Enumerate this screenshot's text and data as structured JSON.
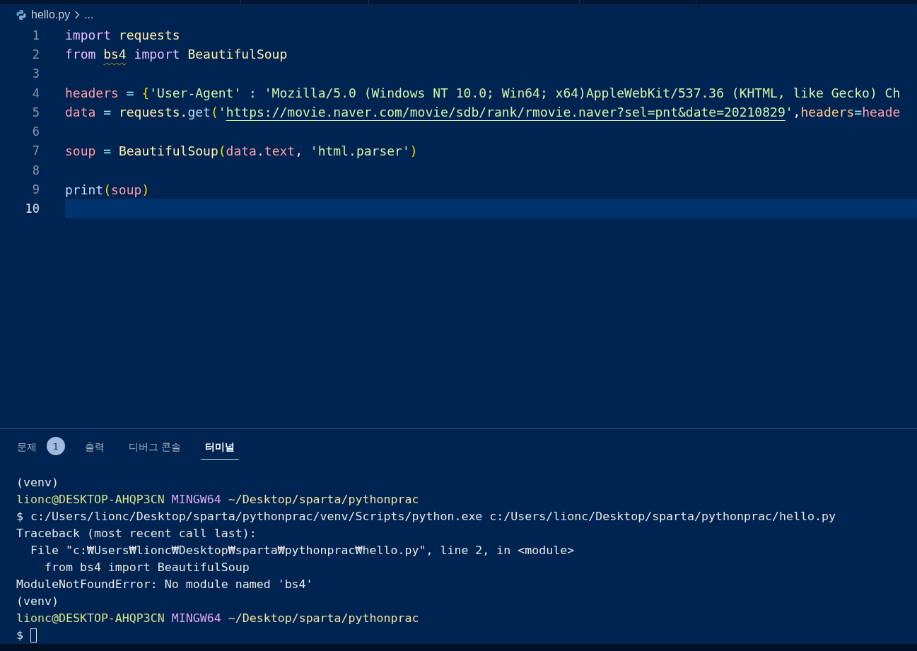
{
  "breadcrumb": {
    "file": "hello.py",
    "more": "..."
  },
  "editor": {
    "lines": [
      {
        "number": "1",
        "current": false,
        "tokens": [
          {
            "kind": "kw",
            "text": "import "
          },
          {
            "kind": "module",
            "text": "requests"
          }
        ]
      },
      {
        "number": "2",
        "current": false,
        "tokens": [
          {
            "kind": "kw",
            "text": "from "
          },
          {
            "kind": "warn",
            "text": "bs4"
          },
          {
            "kind": "kw",
            "text": " import "
          },
          {
            "kind": "module",
            "text": "BeautifulSoup"
          }
        ]
      },
      {
        "number": "3",
        "current": false
      },
      {
        "number": "4",
        "current": false,
        "tokens": [
          {
            "kind": "var",
            "text": "headers"
          },
          {
            "kind": "op",
            "text": " = "
          },
          {
            "kind": "bracket",
            "text": "{"
          },
          {
            "kind": "str",
            "text": "'User-Agent'"
          },
          {
            "kind": "op",
            "text": " : "
          },
          {
            "kind": "str",
            "text": "'Mozilla/5.0 (Windows NT 10.0; Win64; x64)AppleWebKit/537.36 (KHTML, like Gecko) Ch"
          }
        ]
      },
      {
        "number": "5",
        "current": false,
        "tokens": [
          {
            "kind": "var",
            "text": "data"
          },
          {
            "kind": "op",
            "text": " = "
          },
          {
            "kind": "module",
            "text": "requests"
          },
          {
            "kind": "text",
            "text": "."
          },
          {
            "kind": "fn",
            "text": "get"
          },
          {
            "kind": "bracket",
            "text": "("
          },
          {
            "kind": "str",
            "text": "'"
          },
          {
            "kind": "link",
            "text": "https://movie.naver.com/movie/sdb/rank/rmovie.naver?sel=pnt&date=20210829"
          },
          {
            "kind": "str",
            "text": "'"
          },
          {
            "kind": "text",
            "text": ","
          },
          {
            "kind": "param",
            "text": "headers"
          },
          {
            "kind": "op",
            "text": "="
          },
          {
            "kind": "var",
            "text": "heade"
          }
        ]
      },
      {
        "number": "6",
        "current": false
      },
      {
        "number": "7",
        "current": false,
        "tokens": [
          {
            "kind": "var",
            "text": "soup"
          },
          {
            "kind": "op",
            "text": " = "
          },
          {
            "kind": "module",
            "text": "BeautifulSoup"
          },
          {
            "kind": "bracket",
            "text": "("
          },
          {
            "kind": "var",
            "text": "data"
          },
          {
            "kind": "text",
            "text": "."
          },
          {
            "kind": "var",
            "text": "text"
          },
          {
            "kind": "text",
            "text": ", "
          },
          {
            "kind": "str",
            "text": "'html.parser'"
          },
          {
            "kind": "bracket",
            "text": ")"
          }
        ]
      },
      {
        "number": "8",
        "current": false
      },
      {
        "number": "9",
        "current": false,
        "tokens": [
          {
            "kind": "fn",
            "text": "print"
          },
          {
            "kind": "bracket",
            "text": "("
          },
          {
            "kind": "var",
            "text": "soup"
          },
          {
            "kind": "bracket",
            "text": ")"
          }
        ]
      },
      {
        "number": "10",
        "current": true
      }
    ]
  },
  "panel": {
    "tabs": [
      {
        "label": "문제",
        "badge": "1",
        "selected": false
      },
      {
        "label": "출력",
        "selected": false
      },
      {
        "label": "디버그 콘솔",
        "selected": false
      },
      {
        "label": "터미널",
        "selected": true
      }
    ]
  },
  "terminal": {
    "lines": [
      {
        "cursor": false,
        "segments": [
          {
            "kind": "plain",
            "text": "(venv)"
          }
        ]
      },
      {
        "cursor": false,
        "segments": [
          {
            "kind": "user",
            "text": "lionc@DESKTOP-AHQP3CN "
          },
          {
            "kind": "shell",
            "text": "MINGW64 "
          },
          {
            "kind": "path",
            "text": "~/Desktop/sparta/pythonprac"
          }
        ]
      },
      {
        "cursor": false,
        "segments": [
          {
            "kind": "plain",
            "text": "$ c:/Users/lionc/Desktop/sparta/pythonprac/venv/Scripts/python.exe c:/Users/lionc/Desktop/sparta/pythonprac/hello.py"
          }
        ]
      },
      {
        "cursor": false,
        "segments": [
          {
            "kind": "plain",
            "text": "Traceback (most recent call last):"
          }
        ]
      },
      {
        "cursor": false,
        "segments": [
          {
            "kind": "plain",
            "text": "  File \"c:₩Users₩lionc₩Desktop₩sparta₩pythonprac₩hello.py\", line 2, in <module>"
          }
        ]
      },
      {
        "cursor": false,
        "segments": [
          {
            "kind": "plain",
            "text": "    from bs4 import BeautifulSoup"
          }
        ]
      },
      {
        "cursor": false,
        "segments": [
          {
            "kind": "plain",
            "text": "ModuleNotFoundError: No module named 'bs4'"
          }
        ]
      },
      {
        "cursor": false,
        "segments": [
          {
            "kind": "plain",
            "text": "(venv)"
          }
        ]
      },
      {
        "cursor": false,
        "segments": [
          {
            "kind": "user",
            "text": "lionc@DESKTOP-AHQP3CN "
          },
          {
            "kind": "shell",
            "text": "MINGW64 "
          },
          {
            "kind": "path",
            "text": "~/Desktop/sparta/pythonprac"
          }
        ]
      },
      {
        "cursor": true,
        "segments": [
          {
            "kind": "plain",
            "text": "$"
          }
        ]
      }
    ]
  }
}
